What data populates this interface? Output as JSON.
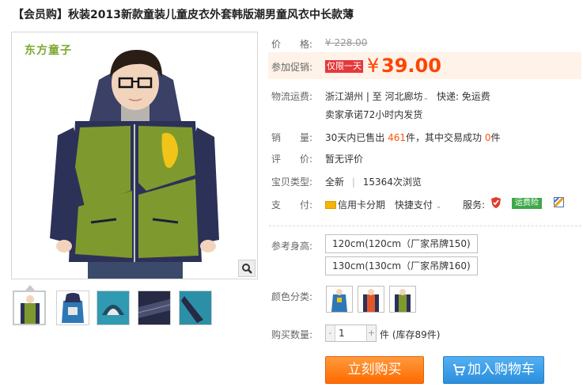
{
  "product_title": "【会员购】秋装2013新款童装儿童皮衣外套韩版潮男童风衣中长款薄",
  "gallery": {
    "brand_logo_text": "东方童子",
    "thumbnails": [
      "front-view",
      "back-view",
      "hood-detail",
      "sleeve-detail",
      "cuff-detail"
    ],
    "active_thumbnail": 0
  },
  "price": {
    "label": "价　　格:",
    "value": "¥ 228.00"
  },
  "promo": {
    "label": "参加促销:",
    "tag": "仅限一天",
    "currency": "¥",
    "value": "39.00"
  },
  "shipping": {
    "label": "物流运费:",
    "from": "浙江湖州",
    "separator": "|",
    "to_prefix": "至",
    "to": "河北廊坊",
    "express": "快递: 免运费",
    "note": "卖家承诺72小时内发货"
  },
  "sales": {
    "label": "销　　量:",
    "prefix": "30天内已售出",
    "count": "461",
    "middle": "件，其中交易成功",
    "success": "0",
    "suffix": "件"
  },
  "rating": {
    "label": "评　　价:",
    "value": "暂无评价"
  },
  "type": {
    "label": "宝贝类型:",
    "value": "全新",
    "separator": "|",
    "views": "15364次浏览"
  },
  "payment": {
    "label": "支　　付:",
    "credit": "信用卡分期",
    "quick": "快捷支付",
    "service_label": "服务:",
    "service_badge": "运费险"
  },
  "size": {
    "label": "参考身高:",
    "options": [
      "120cm(120cm（厂家吊牌150)",
      "130cm(130cm（厂家吊牌160)"
    ]
  },
  "color": {
    "label": "颜色分类:",
    "swatches": [
      "blue-jacket",
      "orange-jacket",
      "green-jacket"
    ]
  },
  "quantity": {
    "label": "购买数量:",
    "value": "1",
    "minus": "-",
    "plus": "+",
    "stock": "件 (库存89件)"
  },
  "actions": {
    "buy_now": "立刻购买",
    "add_to_cart": "加入购物车"
  },
  "colors": {
    "accent_orange": "#ff5500",
    "buy_button": "#ff7a13",
    "cart_button": "#3a9ee8",
    "brand_green": "#7ea832",
    "jacket_green": "#7e9a2e",
    "jacket_navy": "#2c3158"
  }
}
